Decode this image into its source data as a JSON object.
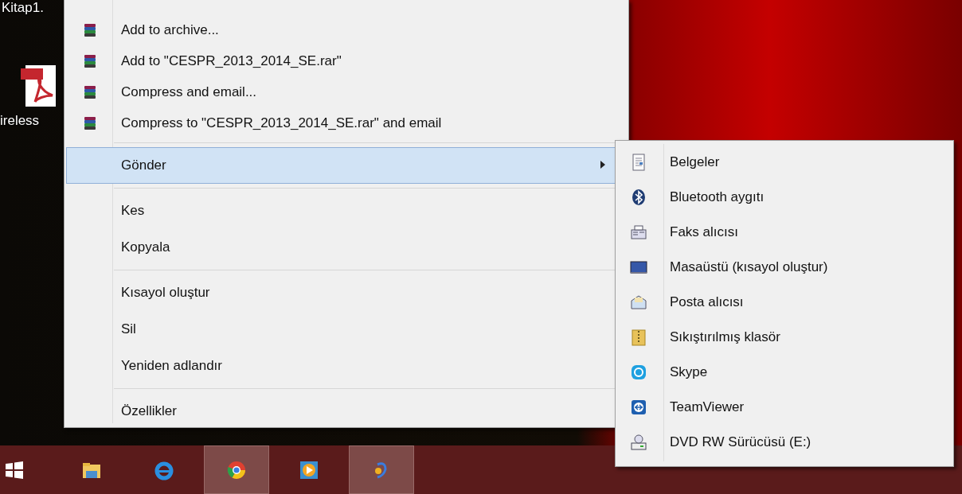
{
  "desktop_icons": [
    {
      "label": "Kitap1.",
      "kind": "blank"
    },
    {
      "label": "ireless",
      "kind": "pdf"
    }
  ],
  "context_menu": {
    "groups": [
      [
        {
          "label": "Add to archive...",
          "kind": "rar",
          "selected": false,
          "has_submenu": false
        },
        {
          "label": "Add to \"CESPR_2013_2014_SE.rar\"",
          "kind": "rar",
          "selected": false,
          "has_submenu": false
        },
        {
          "label": "Compress and email...",
          "kind": "rar",
          "selected": false,
          "has_submenu": false
        },
        {
          "label": "Compress to \"CESPR_2013_2014_SE.rar\" and email",
          "kind": "rar",
          "selected": false,
          "has_submenu": false
        }
      ],
      [
        {
          "label": "Gönder",
          "kind": "plain",
          "selected": true,
          "has_submenu": true
        }
      ],
      [
        {
          "label": "Kes",
          "kind": "plain",
          "selected": false,
          "has_submenu": false
        },
        {
          "label": "Kopyala",
          "kind": "plain",
          "selected": false,
          "has_submenu": false
        }
      ],
      [
        {
          "label": "Kısayol oluştur",
          "kind": "plain",
          "selected": false,
          "has_submenu": false
        },
        {
          "label": "Sil",
          "kind": "plain",
          "selected": false,
          "has_submenu": false
        },
        {
          "label": "Yeniden adlandır",
          "kind": "plain",
          "selected": false,
          "has_submenu": false
        }
      ],
      [
        {
          "label": "Özellikler",
          "kind": "plain",
          "selected": false,
          "has_submenu": false
        }
      ]
    ]
  },
  "submenu": {
    "items": [
      {
        "label": "Belgeler",
        "kind": "document"
      },
      {
        "label": "Bluetooth aygıtı",
        "kind": "bluetooth"
      },
      {
        "label": "Faks alıcısı",
        "kind": "fax"
      },
      {
        "label": "Masaüstü (kısayol oluştur)",
        "kind": "monitor"
      },
      {
        "label": "Posta alıcısı",
        "kind": "mail"
      },
      {
        "label": "Sıkıştırılmış klasör",
        "kind": "zip"
      },
      {
        "label": "Skype",
        "kind": "skype"
      },
      {
        "label": "TeamViewer",
        "kind": "teamviewer"
      },
      {
        "label": "DVD RW Sürücüsü (E:)",
        "kind": "dvd"
      }
    ]
  },
  "taskbar": {
    "items": [
      {
        "kind": "start",
        "active": false
      },
      {
        "kind": "folder",
        "active": false
      },
      {
        "kind": "ie",
        "active": false
      },
      {
        "kind": "chrome",
        "active": true
      },
      {
        "kind": "media",
        "active": false
      },
      {
        "kind": "app",
        "active": true
      }
    ]
  }
}
